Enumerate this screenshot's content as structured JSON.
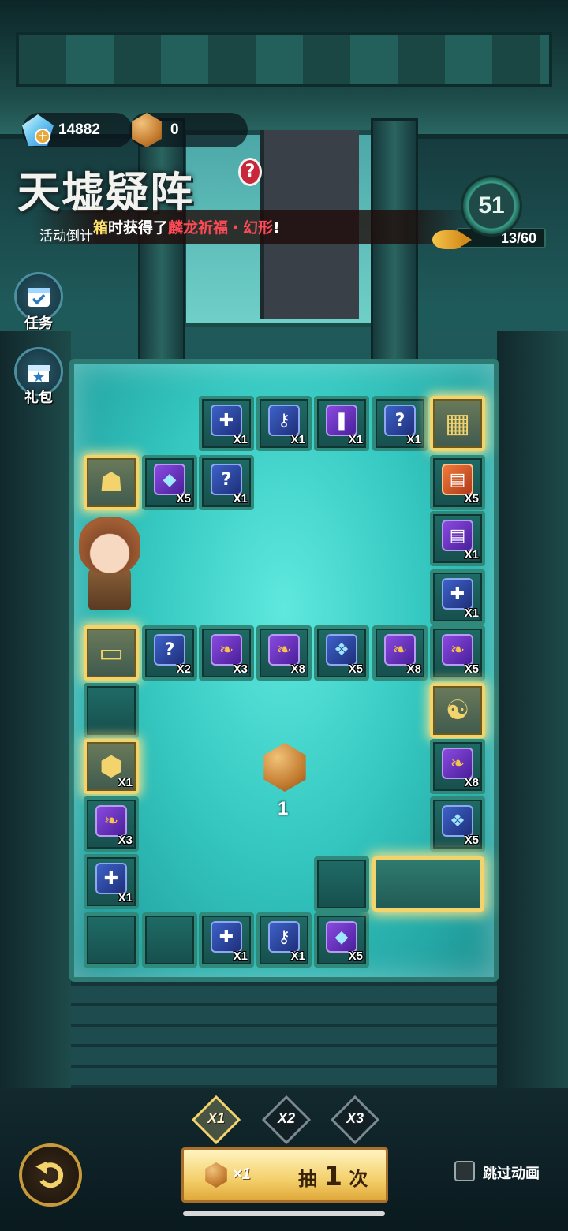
{
  "resources": {
    "gems": "14882",
    "dice": "0"
  },
  "header": {
    "title": "天墟疑阵",
    "help": "?",
    "countdown_label": "活动倒计",
    "notice": {
      "part1": "箱",
      "part2": "时获得了",
      "part3": "麟龙祈福・幻形",
      "part4": "!"
    }
  },
  "progress": {
    "level": "51",
    "count": "13/60"
  },
  "side_buttons": [
    {
      "label": "任务",
      "icon": "task-calendar-icon"
    },
    {
      "label": "礼包",
      "icon": "gift-icon"
    }
  ],
  "board": {
    "tiles": [
      {
        "icon": "syringe-icon",
        "count": "X1",
        "kind": "blue",
        "glyph": "✚"
      },
      {
        "icon": "key-icon",
        "count": "X1",
        "kind": "blue",
        "glyph": "⚷"
      },
      {
        "icon": "potion-icon",
        "count": "X1",
        "kind": "purple",
        "glyph": "❚"
      },
      {
        "icon": "mystery-card-icon",
        "count": "X1",
        "kind": "blue",
        "glyph": "?"
      },
      {
        "icon": "jade-cube-icon",
        "count": "",
        "kind": "special",
        "glyph": "▦"
      },
      {
        "icon": "beast-mask-icon",
        "count": "",
        "kind": "special",
        "glyph": "☗"
      },
      {
        "icon": "diamond-icon",
        "count": "X5",
        "kind": "purple",
        "glyph": "◆"
      },
      {
        "icon": "mystery-card-icon",
        "count": "X1",
        "kind": "blue",
        "glyph": "?"
      },
      {
        "icon": "orange-book-icon",
        "count": "X5",
        "kind": "orange",
        "glyph": "▤"
      },
      {
        "icon": "purple-book-icon",
        "count": "X1",
        "kind": "purple",
        "glyph": "▤"
      },
      {
        "icon": "syringe-icon",
        "count": "X1",
        "kind": "blue",
        "glyph": "✚"
      },
      {
        "icon": "mine-cart-icon",
        "count": "",
        "kind": "special",
        "glyph": "▭"
      },
      {
        "icon": "mystery-card-icon",
        "count": "X2",
        "kind": "blue",
        "glyph": "?"
      },
      {
        "icon": "golden-fish-icon",
        "count": "X3",
        "kind": "purple",
        "glyph": "❧"
      },
      {
        "icon": "golden-fish-icon",
        "count": "X8",
        "kind": "purple",
        "glyph": "❧"
      },
      {
        "icon": "blue-crystal-icon",
        "count": "X5",
        "kind": "blue",
        "glyph": "❖"
      },
      {
        "icon": "golden-fish-icon",
        "count": "X8",
        "kind": "purple",
        "glyph": "❧"
      },
      {
        "icon": "golden-fish-icon",
        "count": "X5",
        "kind": "purple",
        "glyph": "❧"
      },
      {
        "icon": "empty-tile",
        "count": "",
        "kind": "empty",
        "glyph": ""
      },
      {
        "icon": "bagua-icon",
        "count": "",
        "kind": "special",
        "glyph": "☯"
      },
      {
        "icon": "dice-icon",
        "count": "X1",
        "kind": "special",
        "glyph": "⬢"
      },
      {
        "icon": "golden-fish-icon",
        "count": "X8",
        "kind": "purple",
        "glyph": "❧"
      },
      {
        "icon": "golden-fish-icon",
        "count": "X3",
        "kind": "purple",
        "glyph": "❧"
      },
      {
        "icon": "blue-crystal-icon",
        "count": "X5",
        "kind": "blue",
        "glyph": "❖"
      },
      {
        "icon": "syringe-icon",
        "count": "X1",
        "kind": "blue",
        "glyph": "✚"
      },
      {
        "icon": "empty-tile",
        "count": "",
        "kind": "empty",
        "glyph": ""
      },
      {
        "icon": "empty-tile",
        "count": "",
        "kind": "empty",
        "glyph": ""
      },
      {
        "icon": "syringe-icon",
        "count": "X1",
        "kind": "blue",
        "glyph": "✚"
      },
      {
        "icon": "key-icon",
        "count": "X1",
        "kind": "blue",
        "glyph": "⚷"
      },
      {
        "icon": "blue-crystal-icon",
        "count": "X5",
        "kind": "blue",
        "glyph": "❖"
      },
      {
        "icon": "diamond-icon",
        "count": "X5",
        "kind": "purple",
        "glyph": "◆"
      }
    ],
    "dice_roll": "1"
  },
  "controls": {
    "multipliers": [
      "X1",
      "X2",
      "X3"
    ],
    "selected_multiplier": "X1",
    "draw_cost": "×1",
    "draw_pre": "抽",
    "draw_num": "1",
    "draw_post": "次",
    "skip_label": "跳过动画"
  },
  "colors": {
    "accent_gold": "#f3d36b",
    "notice_highlight": "#ff4a55",
    "notice_yellow": "#ffe36a"
  }
}
